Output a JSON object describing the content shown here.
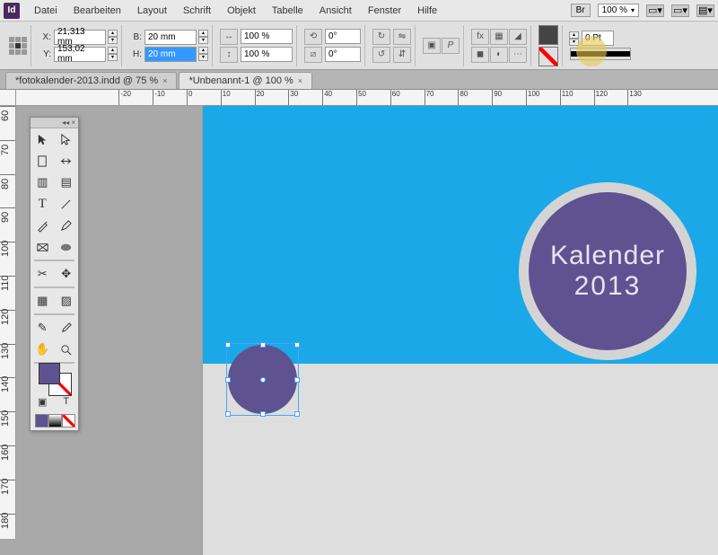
{
  "app_icon": "Id",
  "menu": [
    "Datei",
    "Bearbeiten",
    "Layout",
    "Schrift",
    "Objekt",
    "Tabelle",
    "Ansicht",
    "Fenster",
    "Hilfe"
  ],
  "bridge_label": "Br",
  "zoom_menu": "100 %",
  "control": {
    "x_label": "X:",
    "x_value": "21,313 mm",
    "y_label": "Y:",
    "y_value": "153,02 mm",
    "w_label": "B:",
    "w_value": "20 mm",
    "h_label": "H:",
    "h_value": "20 mm",
    "scale_x": "100 %",
    "scale_y": "100 %",
    "rotate": "0°",
    "shear": "0°",
    "stroke_weight": "0 Pt"
  },
  "tabs": [
    {
      "label": "*fotokalender-2013.indd @ 75 %",
      "active": false
    },
    {
      "label": "*Unbenannt-1 @ 100 %",
      "active": true
    }
  ],
  "ruler_h": [
    -20,
    -10,
    0,
    10,
    20,
    30,
    40,
    50,
    60,
    70,
    80,
    90,
    100,
    110,
    120,
    130
  ],
  "ruler_v": [
    60,
    70,
    80,
    90,
    100,
    110,
    120,
    130,
    140,
    150,
    160,
    170,
    180
  ],
  "canvas": {
    "title_line1": "Kalender",
    "title_line2": "2013"
  }
}
